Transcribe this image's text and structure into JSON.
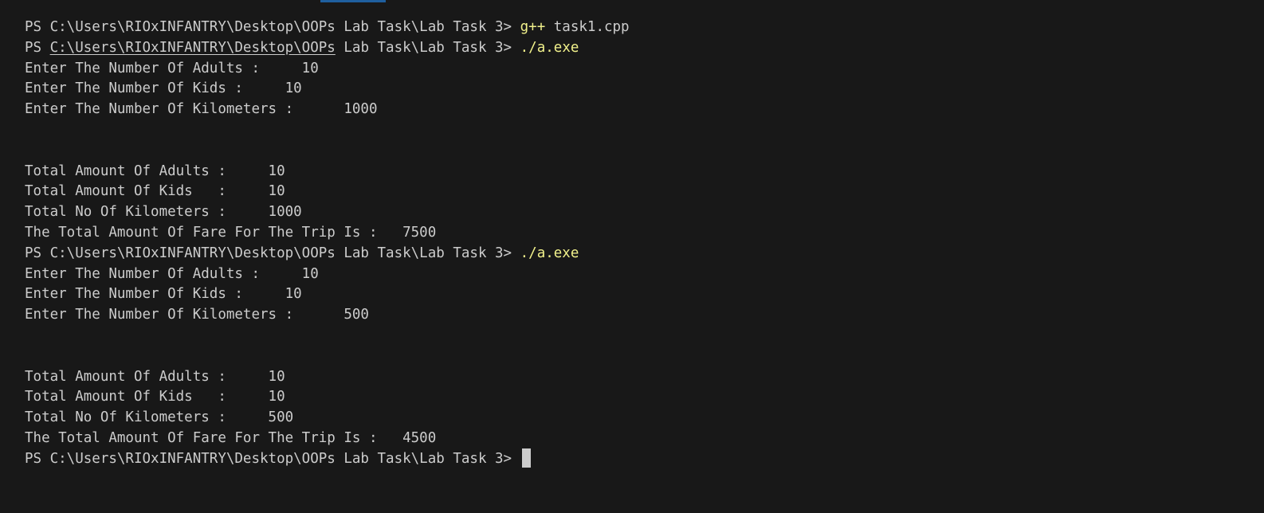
{
  "terminal": {
    "lines": {
      "l1": {
        "prompt": "PS C:\\Users\\RIOxINFANTRY\\Desktop\\OOPs Lab Task\\Lab Task 3> ",
        "cmd": "g++",
        "rest": " task1.cpp"
      },
      "l2": {
        "prompt_pre": "PS ",
        "path_link": "C:\\Users\\RIOxINFANTRY\\Desktop\\OOPs",
        "prompt_post": " Lab Task\\Lab Task 3> ",
        "cmd": "./a.exe"
      },
      "l3": "Enter The Number Of Adults :     10",
      "l4": "Enter The Number Of Kids :     10",
      "l5": "Enter The Number Of Kilometers :      1000",
      "l6": "",
      "l7": "",
      "l8": "Total Amount Of Adults :     10",
      "l9": "Total Amount Of Kids   :     10",
      "l10": "Total No Of Kilometers :     1000",
      "l11": "The Total Amount Of Fare For The Trip Is :   7500",
      "l12": {
        "prompt": "PS C:\\Users\\RIOxINFANTRY\\Desktop\\OOPs Lab Task\\Lab Task 3> ",
        "cmd": "./a.exe"
      },
      "l13": "Enter The Number Of Adults :     10",
      "l14": "Enter The Number Of Kids :     10",
      "l15": "Enter The Number Of Kilometers :      500",
      "l16": "",
      "l17": "",
      "l18": "Total Amount Of Adults :     10",
      "l19": "Total Amount Of Kids   :     10",
      "l20": "Total No Of Kilometers :     500",
      "l21": "The Total Amount Of Fare For The Trip Is :   4500",
      "l22": {
        "prompt": "PS C:\\Users\\RIOxINFANTRY\\Desktop\\OOPs Lab Task\\Lab Task 3> "
      }
    },
    "colors": {
      "background": "#181818",
      "text": "#cccccc",
      "command": "#f1f18b",
      "accent": "#1f5f9e"
    }
  }
}
